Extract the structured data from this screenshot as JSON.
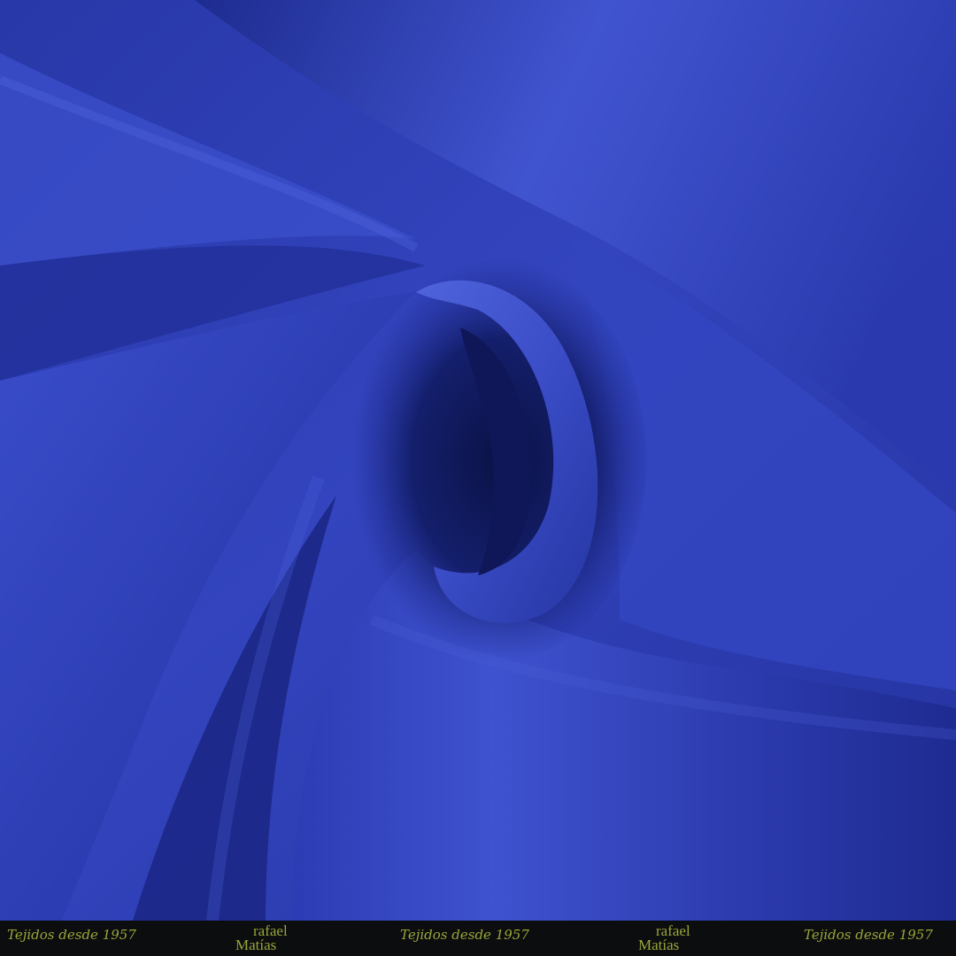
{
  "photo": {
    "subject": "blue satin fabric swirl",
    "colors": {
      "base": "#2e3fb6",
      "highlight": "#4a5fd8",
      "shadow": "#14206f",
      "deep_shadow": "#0d1550"
    }
  },
  "branding": {
    "tagline": "Tejidos desde 1957",
    "logo_line1": "rafael",
    "logo_line2": "Matías",
    "text_color": "#9aa63a",
    "strip_color": "#0c0d0e"
  }
}
